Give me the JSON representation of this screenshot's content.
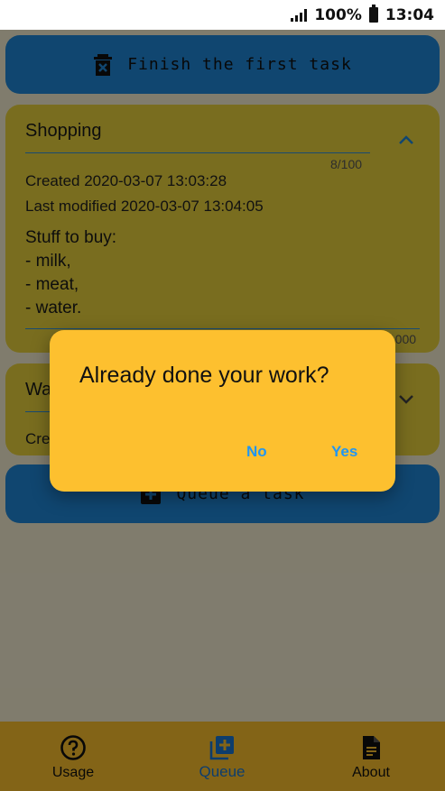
{
  "status_bar": {
    "battery": "100%",
    "time": "13:04"
  },
  "actions": {
    "finish_label": "Finish the first task",
    "queue_label": "Queue a task"
  },
  "tasks": [
    {
      "title": "Shopping",
      "title_counter": "8/100",
      "created": "Created 2020-03-07 13:03:28",
      "modified": "Last modified 2020-03-07 13:04:05",
      "body": "Stuff to buy:\n- milk,\n- meat,\n- water.",
      "body_counter": "/1000"
    },
    {
      "title": "Wa",
      "created": "Cre"
    }
  ],
  "dialog": {
    "title": "Already done your work?",
    "no_label": "No",
    "yes_label": "Yes"
  },
  "nav": {
    "items": [
      {
        "label": "Usage",
        "icon": "help-circle-icon"
      },
      {
        "label": "Queue",
        "icon": "add-queue-icon",
        "selected": true
      },
      {
        "label": "About",
        "icon": "document-icon"
      }
    ]
  },
  "colors": {
    "primary_blue": "#1f86d6",
    "card_yellow": "#e9d23c",
    "dialog_yellow": "#fdc02f",
    "accent_blue": "#2196f3",
    "nav_bg": "#fbc02d"
  }
}
